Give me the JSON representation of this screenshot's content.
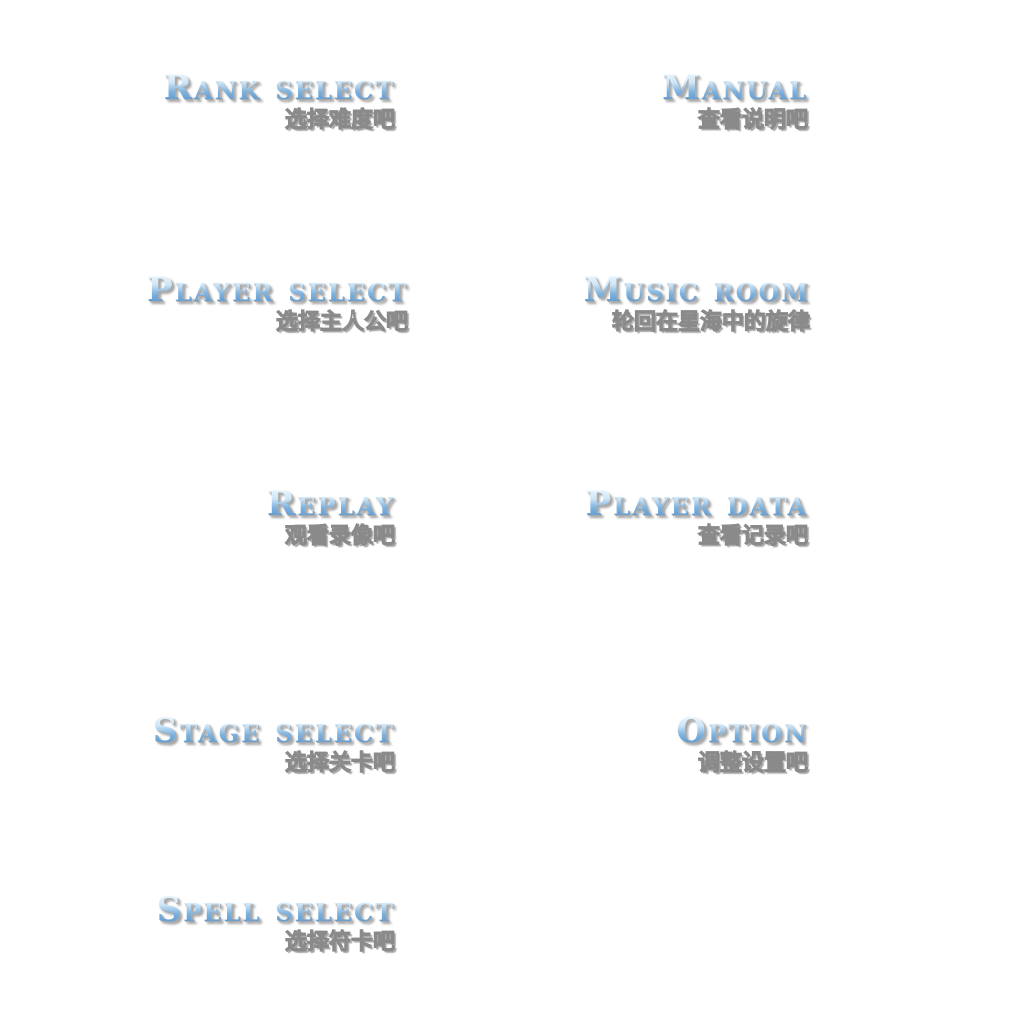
{
  "menu": {
    "rank_select": {
      "title": "Rank select",
      "subtitle": "选择难度吧"
    },
    "manual": {
      "title": "Manual",
      "subtitle": "查看说明吧"
    },
    "player_select": {
      "title": "Player select",
      "subtitle": "选择主人公吧"
    },
    "music_room": {
      "title": "Music room",
      "subtitle": "轮回在星海中的旋律"
    },
    "replay": {
      "title": "Replay",
      "subtitle": "观看录像吧"
    },
    "player_data": {
      "title": "Player data",
      "subtitle": "查看记录吧"
    },
    "stage_select": {
      "title": "Stage select",
      "subtitle": "选择关卡吧"
    },
    "option": {
      "title": "Option",
      "subtitle": "调整设置吧"
    },
    "spell_select": {
      "title": "Spell select",
      "subtitle": "选择符卡吧"
    }
  }
}
